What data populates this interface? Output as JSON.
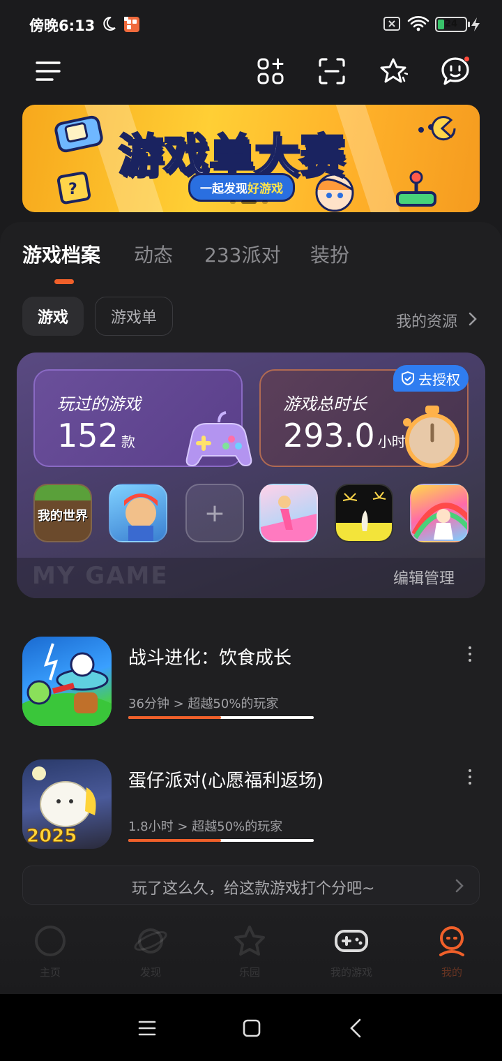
{
  "status_bar": {
    "time": "傍晚6:13",
    "battery": "24",
    "battery_level": 0.24
  },
  "app_bar": {
    "icons": [
      "menu-icon",
      "app-grid-add-icon",
      "scan-icon",
      "star-sparkle-icon",
      "message-icon"
    ]
  },
  "banner": {
    "title": "游戏单大赛",
    "subtitle_prefix": "一起发现",
    "subtitle_highlight": "好游戏",
    "page_count": 3,
    "active_page": 1
  },
  "tabs": [
    {
      "label": "游戏档案",
      "active": true
    },
    {
      "label": "动态",
      "active": false
    },
    {
      "label": "233派对",
      "active": false
    },
    {
      "label": "装扮",
      "active": false
    }
  ],
  "filter": {
    "chips": [
      "游戏",
      "游戏单"
    ],
    "active": 0,
    "my_resources": "我的资源"
  },
  "my_game": {
    "played_label": "玩过的游戏",
    "played_value": "152",
    "played_unit": "款",
    "time_label": "游戏总时长",
    "time_value": "293.0",
    "time_unit": "小时",
    "auth_badge": "去授权",
    "thumb_minecraft": "我的世界",
    "watermark": "MY GAME",
    "edit_manage": "编辑管理"
  },
  "games": [
    {
      "name": "战斗进化：饮食成长",
      "meta": "36分钟 > 超越50%的玩家",
      "progress": 0.5
    },
    {
      "name": "蛋仔派对(心愿福利返场)",
      "meta": "1.8小时 > 超越50%的玩家",
      "progress": 0.5,
      "badge": "2025"
    }
  ],
  "rating_prompt": "玩了这么久，给这款游戏打个分吧~",
  "bottom_nav": [
    {
      "label": "主页",
      "icon": "home-icon"
    },
    {
      "label": "发现",
      "icon": "planet-icon"
    },
    {
      "label": "乐园",
      "icon": "star-icon"
    },
    {
      "label": "我的游戏",
      "icon": "gamepad-icon"
    },
    {
      "label": "我的",
      "icon": "profile-icon",
      "active": true
    }
  ],
  "colors": {
    "accent": "#f0602a",
    "background": "#1b1b1d",
    "badge_blue": "#2f7df0"
  }
}
